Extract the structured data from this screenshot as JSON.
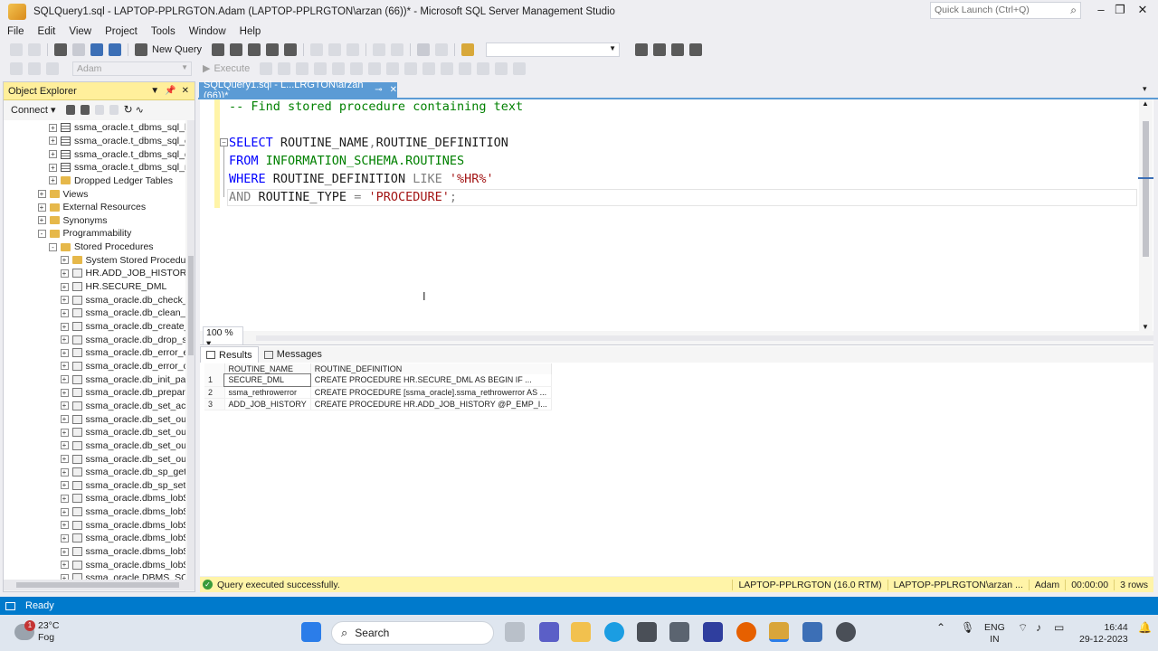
{
  "window": {
    "title": "SQLQuery1.sql - LAPTOP-PPLRGTON.Adam (LAPTOP-PPLRGTON\\arzan (66))* - Microsoft SQL Server Management Studio",
    "quick_launch_placeholder": "Quick Launch (Ctrl+Q)"
  },
  "menu": [
    "File",
    "Edit",
    "View",
    "Project",
    "Tools",
    "Window",
    "Help"
  ],
  "toolbar": {
    "new_query": "New Query",
    "database": "Adam",
    "execute": "Execute"
  },
  "object_explorer": {
    "title": "Object Explorer",
    "connect": "Connect",
    "tree": [
      {
        "level": 4,
        "icon": "table",
        "expander": "+",
        "label": "ssma_oracle.t_dbms_sql_b"
      },
      {
        "level": 4,
        "icon": "table",
        "expander": "+",
        "label": "ssma_oracle.t_dbms_sql_c"
      },
      {
        "level": 4,
        "icon": "table",
        "expander": "+",
        "label": "ssma_oracle.t_dbms_sql_d"
      },
      {
        "level": 4,
        "icon": "table",
        "expander": "+",
        "label": "ssma_oracle.t_dbms_sql_re"
      },
      {
        "level": 4,
        "icon": "folder",
        "expander": "+",
        "label": "Dropped Ledger Tables"
      },
      {
        "level": 3,
        "icon": "folder",
        "expander": "+",
        "label": "Views"
      },
      {
        "level": 3,
        "icon": "folder",
        "expander": "+",
        "label": "External Resources"
      },
      {
        "level": 3,
        "icon": "folder",
        "expander": "+",
        "label": "Synonyms"
      },
      {
        "level": 3,
        "icon": "folder",
        "expander": "-",
        "label": "Programmability"
      },
      {
        "level": 4,
        "icon": "folder",
        "expander": "-",
        "label": "Stored Procedures"
      },
      {
        "level": 5,
        "icon": "folder",
        "expander": "+",
        "label": "System Stored Procedu"
      },
      {
        "level": 5,
        "icon": "proc",
        "expander": "+",
        "label": "HR.ADD_JOB_HISTORY"
      },
      {
        "level": 5,
        "icon": "proc",
        "expander": "+",
        "label": "HR.SECURE_DML"
      },
      {
        "level": 5,
        "icon": "proc",
        "expander": "+",
        "label": "ssma_oracle.db_check_"
      },
      {
        "level": 5,
        "icon": "proc",
        "expander": "+",
        "label": "ssma_oracle.db_clean_s"
      },
      {
        "level": 5,
        "icon": "proc",
        "expander": "+",
        "label": "ssma_oracle.db_create_"
      },
      {
        "level": 5,
        "icon": "proc",
        "expander": "+",
        "label": "ssma_oracle.db_drop_s"
      },
      {
        "level": 5,
        "icon": "proc",
        "expander": "+",
        "label": "ssma_oracle.db_error_e"
      },
      {
        "level": 5,
        "icon": "proc",
        "expander": "+",
        "label": "ssma_oracle.db_error_c"
      },
      {
        "level": 5,
        "icon": "proc",
        "expander": "+",
        "label": "ssma_oracle.db_init_pa"
      },
      {
        "level": 5,
        "icon": "proc",
        "expander": "+",
        "label": "ssma_oracle.db_prepar"
      },
      {
        "level": 5,
        "icon": "proc",
        "expander": "+",
        "label": "ssma_oracle.db_set_act"
      },
      {
        "level": 5,
        "icon": "proc",
        "expander": "+",
        "label": "ssma_oracle.db_set_ou"
      },
      {
        "level": 5,
        "icon": "proc",
        "expander": "+",
        "label": "ssma_oracle.db_set_ou"
      },
      {
        "level": 5,
        "icon": "proc",
        "expander": "+",
        "label": "ssma_oracle.db_set_ou"
      },
      {
        "level": 5,
        "icon": "proc",
        "expander": "+",
        "label": "ssma_oracle.db_set_ou"
      },
      {
        "level": 5,
        "icon": "proc",
        "expander": "+",
        "label": "ssma_oracle.db_sp_get"
      },
      {
        "level": 5,
        "icon": "proc",
        "expander": "+",
        "label": "ssma_oracle.db_sp_set_"
      },
      {
        "level": 5,
        "icon": "proc",
        "expander": "+",
        "label": "ssma_oracle.dbms_lob$"
      },
      {
        "level": 5,
        "icon": "proc",
        "expander": "+",
        "label": "ssma_oracle.dbms_lob$"
      },
      {
        "level": 5,
        "icon": "proc",
        "expander": "+",
        "label": "ssma_oracle.dbms_lob$"
      },
      {
        "level": 5,
        "icon": "proc",
        "expander": "+",
        "label": "ssma_oracle.dbms_lob$"
      },
      {
        "level": 5,
        "icon": "proc",
        "expander": "+",
        "label": "ssma_oracle.dbms_lob$"
      },
      {
        "level": 5,
        "icon": "proc",
        "expander": "+",
        "label": "ssma_oracle.dbms_lob$"
      },
      {
        "level": 5,
        "icon": "proc",
        "expander": "+",
        "label": "ssma_oracle.DBMS_SQ"
      }
    ]
  },
  "editor": {
    "tab_label": "SQLQuery1.sql - L...LRGTON\\arzan (66))*",
    "zoom": "100 %",
    "lines": {
      "comment": "-- Find stored procedure containing text",
      "select_kw": "SELECT",
      "select_cols": " ROUTINE_NAME",
      "comma": ",",
      "select_col2": "ROUTINE_DEFINITION",
      "from_kw": "FROM",
      "from_obj": "INFORMATION_SCHEMA.ROUTINES",
      "where_kw": "WHERE",
      "where_col": " ROUTINE_DEFINITION ",
      "like_kw": "LIKE",
      "like_val": "'%HR%'",
      "and_kw": "AND",
      "and_col": " ROUTINE_TYPE ",
      "eq": "=",
      "and_val": "'PROCEDURE'",
      "semi": ";"
    }
  },
  "results": {
    "tabs": [
      "Results",
      "Messages"
    ],
    "columns": [
      "ROUTINE_NAME",
      "ROUTINE_DEFINITION"
    ],
    "rows": [
      {
        "n": "1",
        "name": "SECURE_DML",
        "def": "CREATE PROCEDURE HR.SECURE_DML   AS      BEGIN      IF ..."
      },
      {
        "n": "2",
        "name": "ssma_rethrowerror",
        "def": "CREATE PROCEDURE [ssma_oracle].ssma_rethrowerror AS   ..."
      },
      {
        "n": "3",
        "name": "ADD_JOB_HISTORY",
        "def": "CREATE PROCEDURE HR.ADD_JOB_HISTORY      @P_EMP_I..."
      }
    ]
  },
  "query_status": {
    "message": "Query executed successfully.",
    "server": "LAPTOP-PPLRGTON (16.0 RTM)",
    "user": "LAPTOP-PPLRGTON\\arzan ...",
    "database": "Adam",
    "elapsed": "00:00:00",
    "rows": "3 rows"
  },
  "status_bar": {
    "text": "Ready"
  },
  "taskbar": {
    "weather_temp": "23°C",
    "weather_desc": "Fog",
    "weather_badge": "1",
    "search": "Search",
    "lang1": "ENG",
    "lang2": "IN",
    "time": "16:44",
    "date": "29-12-2023"
  }
}
